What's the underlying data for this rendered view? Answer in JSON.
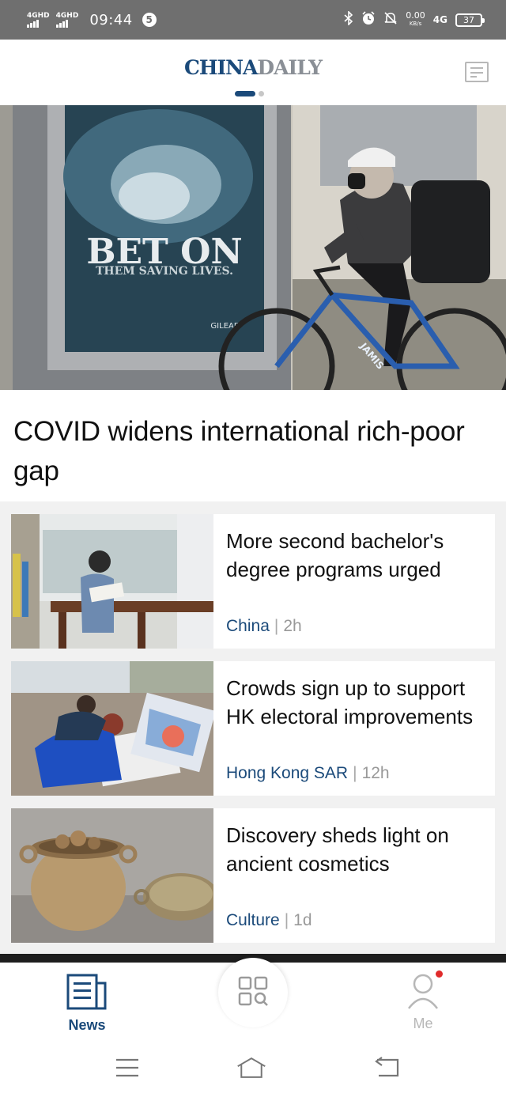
{
  "status_bar": {
    "sim1_type": "4GHD",
    "sim2_type": "4GHD",
    "time": "09:44",
    "notification_count": "5",
    "net_speed": "0.00",
    "net_speed_unit": "KB/s",
    "network": "4G",
    "battery": "37"
  },
  "header": {
    "logo_part1": "CHINA",
    "logo_part2": "DAILY",
    "layout_icon": "newspaper-layout-icon",
    "page_indicator": {
      "count": 2,
      "active": 0
    }
  },
  "hero": {
    "poster_line1": "BET ON",
    "poster_line2": "THEM SAVING LIVES.",
    "poster_brand": "GILEAD",
    "bike_brand": "JAMIS",
    "title": "COVID widens international rich-poor gap"
  },
  "news_items": [
    {
      "headline": "More second bachelor's degree programs urged",
      "category": "China",
      "age": "2h",
      "thumb": "student-studying-in-library"
    },
    {
      "headline": "Crowds sign up to support HK electoral improvements",
      "category": "Hong Kong SAR",
      "age": "12h",
      "thumb": "people-signing-at-street-booth"
    },
    {
      "headline": "Discovery sheds light on ancient cosmetics",
      "category": "Culture",
      "age": "1d",
      "thumb": "ancient-pot-and-lid"
    }
  ],
  "meta_separator": "|",
  "bottom_nav": {
    "news_label": "News",
    "me_label": "Me",
    "center_icon": "grid-search-icon",
    "me_has_notification": true
  },
  "system_nav": [
    "menu-icon",
    "home-icon",
    "back-icon"
  ],
  "colors": {
    "brand_blue": "#1b4a7a",
    "logo_gray": "#8a8f96",
    "status_bar": "#6f6f6f",
    "notification_red": "#e02b2b"
  }
}
